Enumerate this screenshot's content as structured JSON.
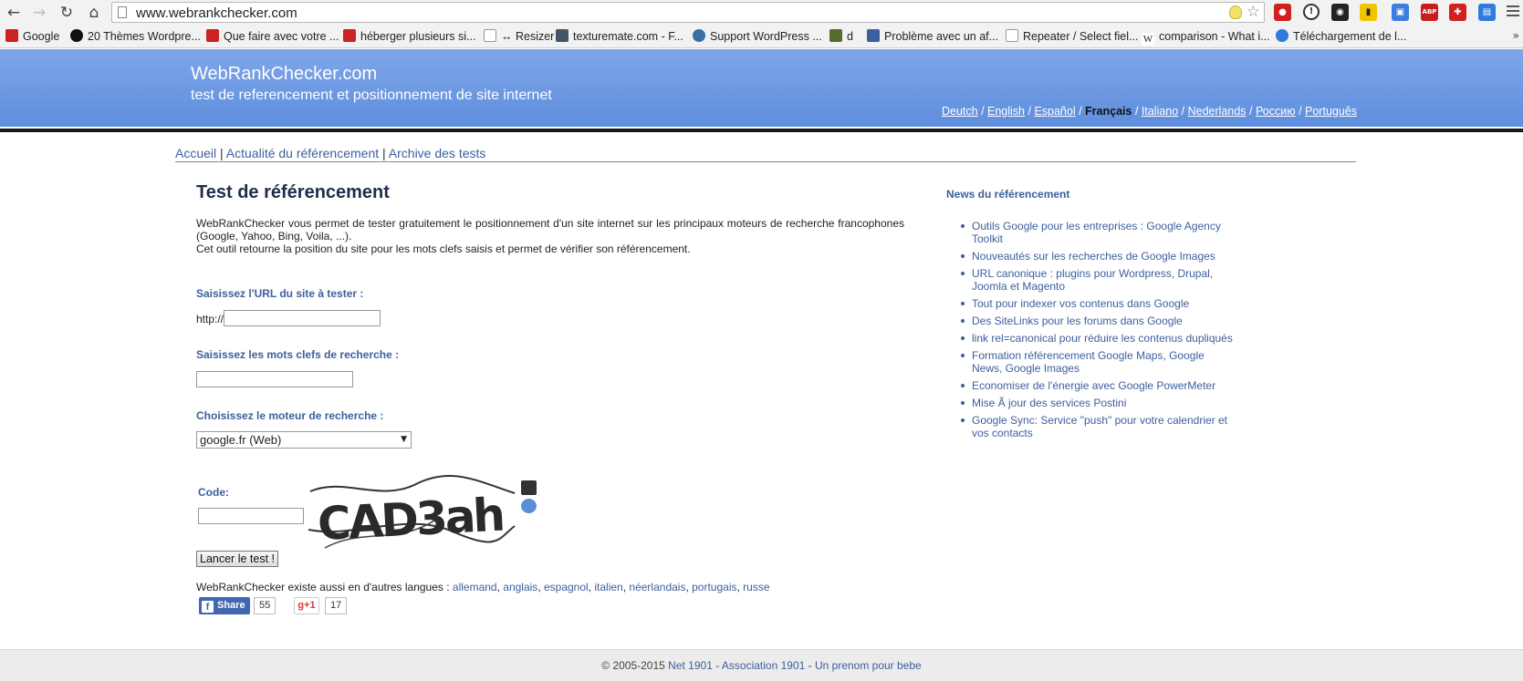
{
  "browser": {
    "url": "www.webrankchecker.com",
    "bookmarks": [
      {
        "label": "Google",
        "color": "#cc2222"
      },
      {
        "label": "20 Thèmes Wordpre...",
        "color": "#111111"
      },
      {
        "label": "Que faire avec votre ...",
        "color": "#cc2222"
      },
      {
        "label": "héberger plusieurs si...",
        "color": "#cc2222"
      },
      {
        "label": "↔ Resizer",
        "color": "#ffffff"
      },
      {
        "label": "texturemate.com - F...",
        "color": "#445566"
      },
      {
        "label": "Support WordPress ...",
        "color": "#3b6ea5"
      },
      {
        "label": "d",
        "color": "#556b2f"
      },
      {
        "label": "Problème avec un af...",
        "color": "#3d5f9c"
      },
      {
        "label": "Repeater / Select fiel...",
        "color": "#ffffff"
      },
      {
        "label": "comparison - What i...",
        "color": "#ffffff"
      },
      {
        "label": "Téléchargement de l...",
        "color": "#2f7be0"
      }
    ],
    "bookmarks_more": "»",
    "w_glyph": "W"
  },
  "header": {
    "title": "WebRankChecker.com",
    "subtitle": "test de referencement et positionnement de site internet",
    "languages": [
      "Deutch",
      "English",
      "Español",
      "Français",
      "Italiano",
      "Nederlands",
      "Россию",
      "Português"
    ],
    "current_language": "Français"
  },
  "nav": {
    "items": [
      "Accueil",
      "Actualité du référencement",
      "Archive des tests"
    ]
  },
  "main": {
    "title": "Test de référencement",
    "intro_1": "WebRankChecker vous permet de tester gratuitement le positionnement d'un site internet sur les principaux moteurs de recherche francophones (Google, Yahoo, Bing, Voila, ...).",
    "intro_2": "Cet outil retourne la position du site pour les mots clefs saisis et permet de vérifier son référencement.",
    "url_label": "Saisissez l'URL du site à tester :",
    "url_prefix": "http://",
    "url_value": "",
    "keywords_label": "Saisissez les mots clefs de recherche :",
    "keywords_value": "",
    "engine_label": "Choisissez le moteur de recherche :",
    "engine_selected": "google.fr (Web)",
    "code_label": "Code:",
    "code_value": "",
    "captcha_text": "CAD3ah",
    "submit_label": "Lancer le test !",
    "other_langs_prefix": "WebRankChecker existe aussi en d'autres langues :",
    "other_langs": [
      "allemand",
      "anglais",
      "espagnol",
      "italien",
      "néerlandais",
      "portugais",
      "russe"
    ],
    "fb_share_label": "Share",
    "fb_count": "55",
    "gplus_label": "g+1",
    "gplus_count": "17"
  },
  "sidebar": {
    "title": "News du référencement",
    "news": [
      "Outils Google pour les entreprises : Google Agency Toolkit",
      "Nouveautés sur les recherches de Google Images",
      "URL canonique : plugins pour Wordpress, Drupal, Joomla et Magento",
      "Tout pour indexer vos contenus dans Google",
      "Des SiteLinks pour les forums dans Google",
      "link rel=canonical pour réduire les contenus dupliqués",
      "Formation référencement Google Maps, Google News, Google Images",
      "Economiser de l'énergie avec Google PowerMeter",
      "Mise Ã  jour des services Postini",
      "Google Sync: Service \"push\" pour votre calendrier et vos contacts"
    ]
  },
  "footer": {
    "copyright": "© 2005-2015",
    "link1": "Net 1901",
    "link2": "Association 1901",
    "link3": "Un prenom pour bebe"
  },
  "colors": {
    "header_top": "#7fa6e8",
    "header_bottom": "#5f8ede",
    "link": "#3d5f9c",
    "title": "#1e2d4a"
  }
}
